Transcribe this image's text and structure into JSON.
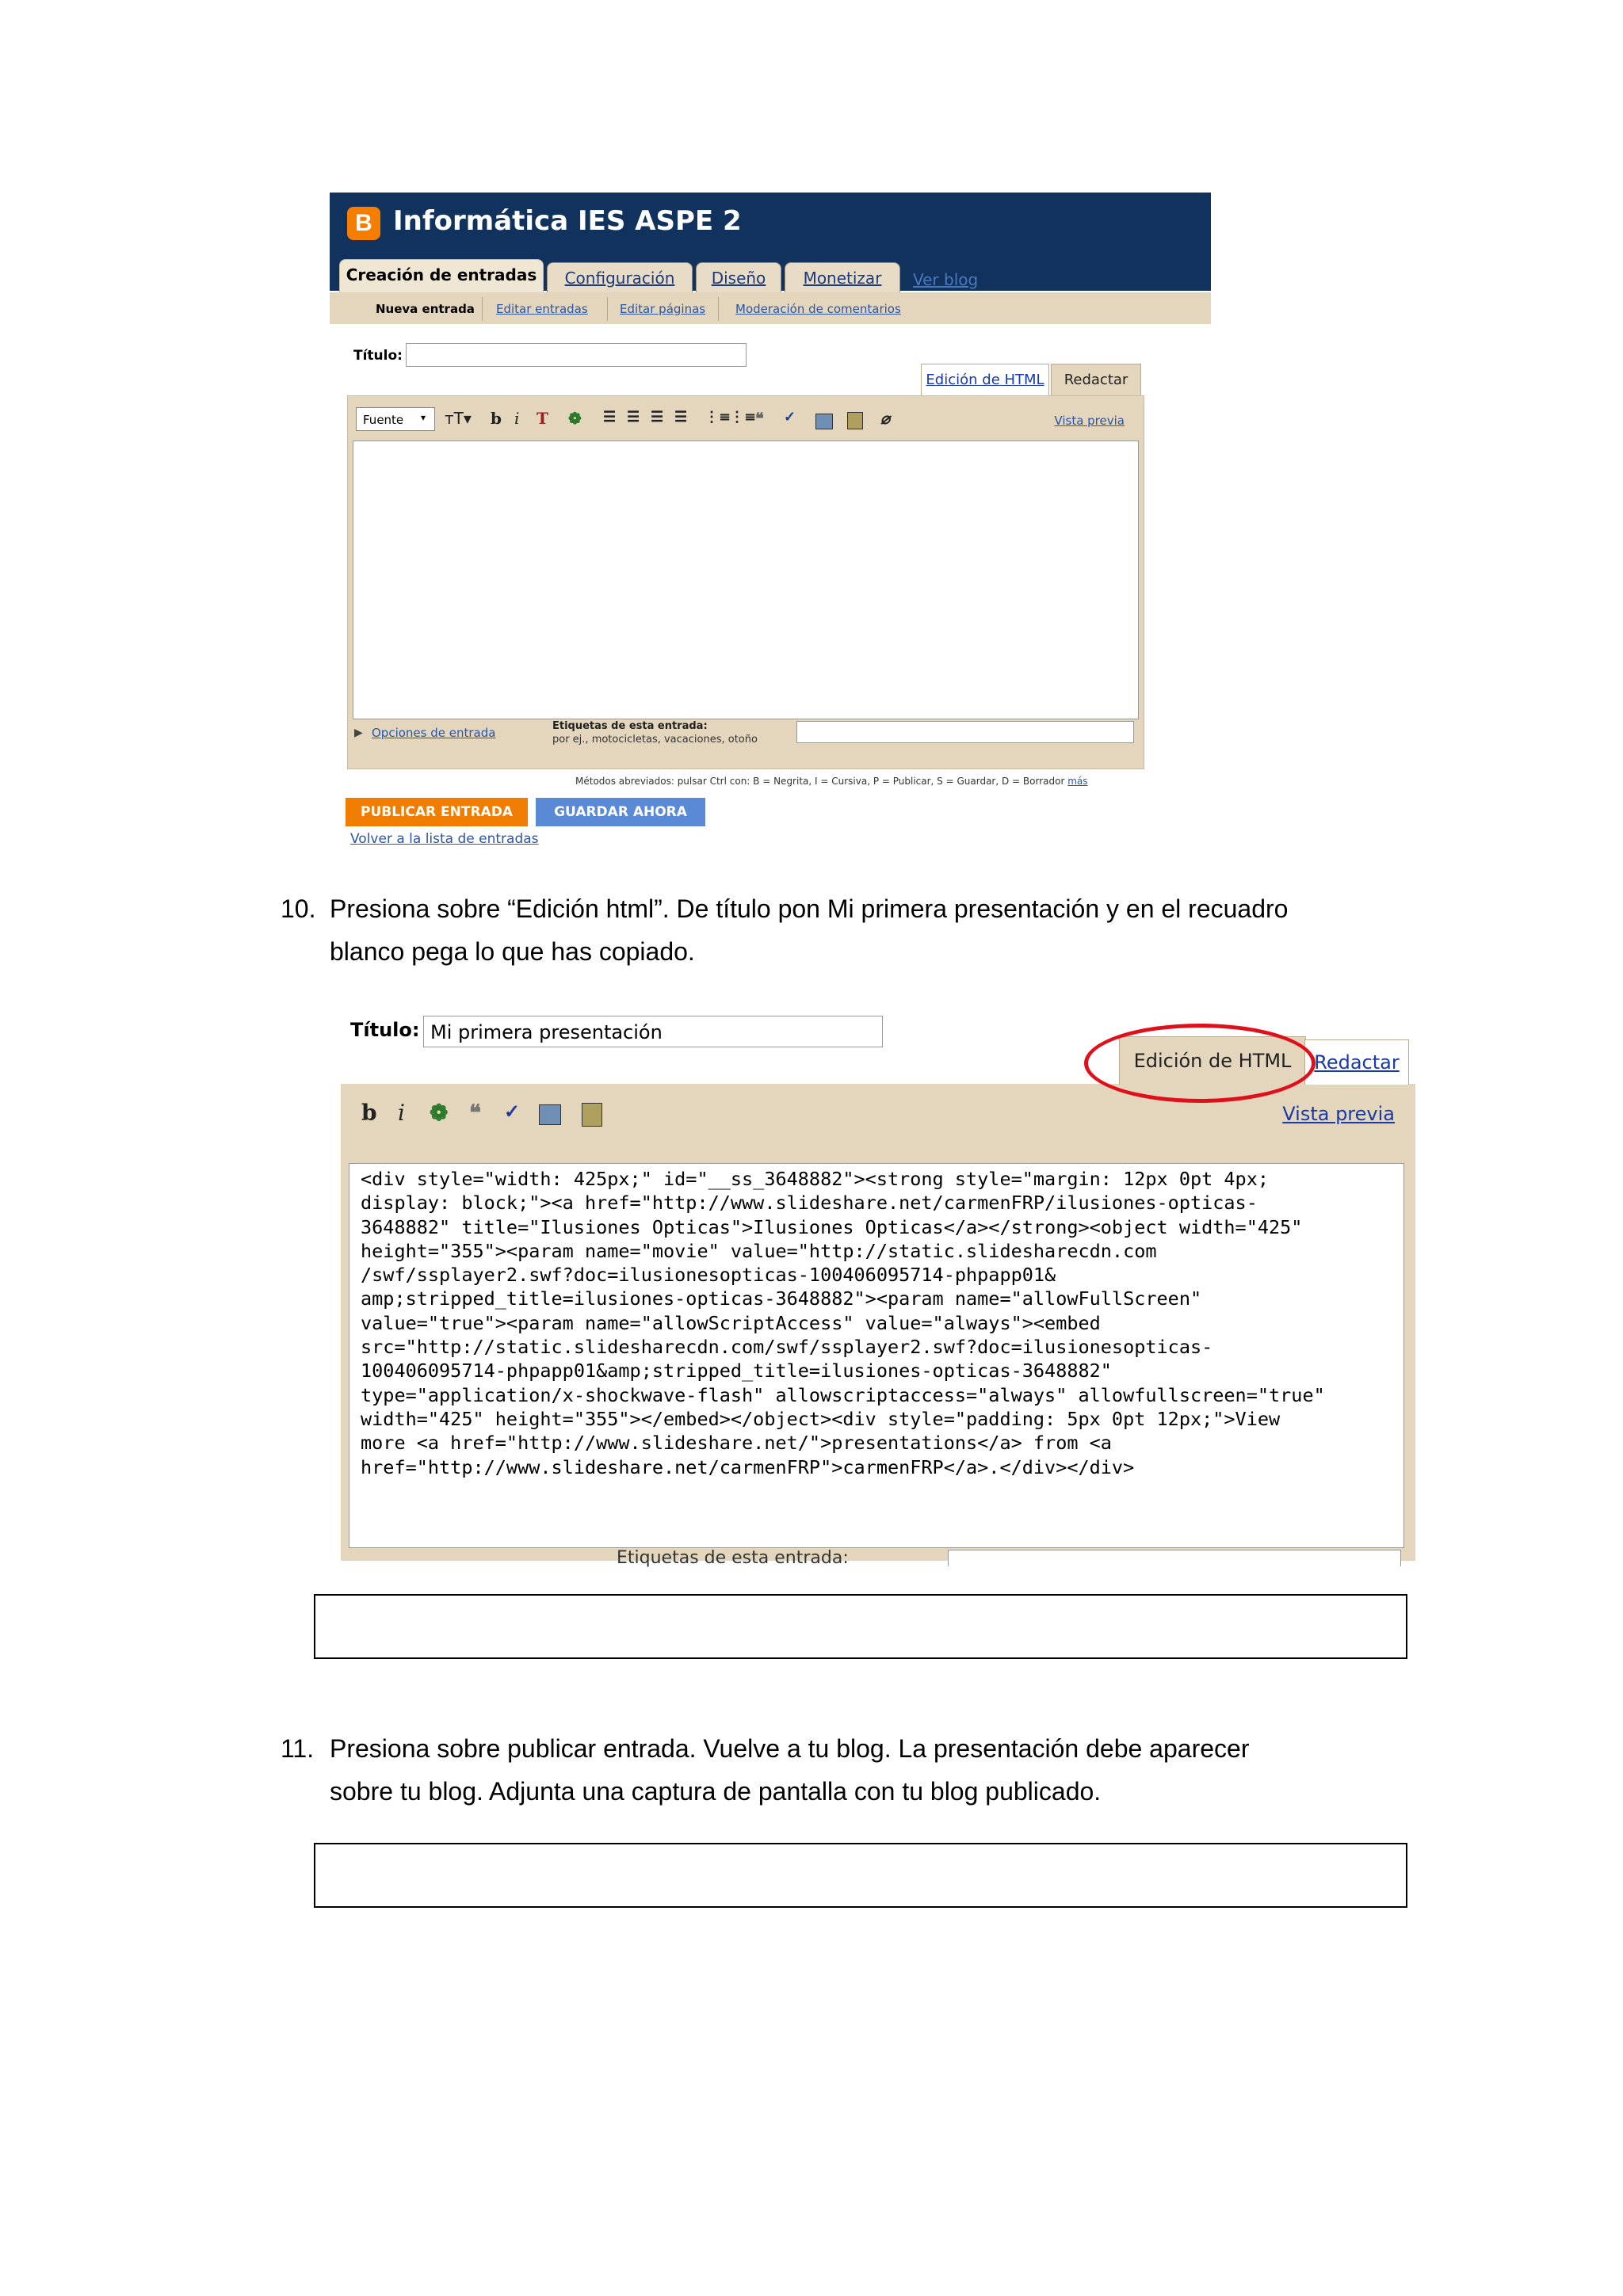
{
  "screenshot1": {
    "blog_title": "Informática IES ASPE 2",
    "logo_letter": "B",
    "tabs": [
      "Creación de entradas",
      "Configuración",
      "Diseño",
      "Monetizar"
    ],
    "ver_blog": "Ver blog",
    "subnav": [
      "Nueva entrada",
      "Editar entradas",
      "Editar páginas",
      "Moderación de comentarios"
    ],
    "titulo_label": "Título:",
    "edit_tabs": [
      "Edición de HTML",
      "Redactar"
    ],
    "font_select": "Fuente",
    "vista_previa": "Vista previa",
    "opciones": "Opciones de entrada",
    "etiquetas_label": "Etiquetas de esta entrada:",
    "etiquetas_hint": "por ej., motocicletas, vacaciones, otoño",
    "metodos": "Métodos abreviados: pulsar Ctrl con: B = Negrita, I = Cursiva, P = Publicar, S = Guardar, D = Borrador",
    "metodos_link": "más",
    "publicar": "PUBLICAR ENTRADA",
    "guardar": "GUARDAR AHORA",
    "volver": "Volver a la lista de entradas"
  },
  "step10": {
    "number": "10.",
    "line1": "Presiona sobre “Edición html”. De título pon Mi primera presentación y en el recuadro",
    "line2": "blanco pega lo que has copiado."
  },
  "screenshot2": {
    "titulo_label": "Título:",
    "titulo_value": "Mi primera presentación",
    "edit_html_tab": "Edición de HTML",
    "redactar_tab": "Redactar",
    "vista_previa": "Vista previa",
    "code_lines": [
      "<div style=\"width: 425px;\" id=\"__ss_3648882\"><strong style=\"margin: 12px 0pt 4px;",
      "display: block;\"><a href=\"http://www.slideshare.net/carmenFRP/ilusiones-opticas-",
      "3648882\" title=\"Ilusiones Opticas\">Ilusiones Opticas</a></strong><object width=\"425\"",
      "height=\"355\"><param name=\"movie\" value=\"http://static.slidesharecdn.com",
      "/swf/ssplayer2.swf?doc=ilusionesopticas-100406095714-phpapp01&",
      "amp;stripped_title=ilusiones-opticas-3648882\"><param name=\"allowFullScreen\"",
      "value=\"true\"><param name=\"allowScriptAccess\" value=\"always\"><embed",
      "src=\"http://static.slidesharecdn.com/swf/ssplayer2.swf?doc=ilusionesopticas-",
      "100406095714-phpapp01&amp;stripped_title=ilusiones-opticas-3648882\"",
      "type=\"application/x-shockwave-flash\" allowscriptaccess=\"always\" allowfullscreen=\"true\"",
      "width=\"425\" height=\"355\"></embed></object><div style=\"padding: 5px 0pt 12px;\">View",
      "more <a href=\"http://www.slideshare.net/\">presentations</a> from <a",
      "href=\"http://www.slideshare.net/carmenFRP\">carmenFRP</a>.</div></div>"
    ],
    "etiquetas_label": "Etiquetas de esta entrada:"
  },
  "step11": {
    "number": "11.",
    "line1": "Presiona sobre publicar entrada. Vuelve a tu blog. La presentación debe aparecer",
    "line2": "sobre tu blog. Adjunta una captura de pantalla con tu blog publicado."
  },
  "icons": [
    "blogger-logo-icon",
    "text-size-icon",
    "bold-icon",
    "italic-icon",
    "text-color-icon",
    "link-icon",
    "align-left-icon",
    "align-center-icon",
    "align-right-icon",
    "justify-icon",
    "numbered-list-icon",
    "bullet-list-icon",
    "blockquote-icon",
    "spellcheck-icon",
    "image-icon",
    "video-icon",
    "eraser-icon"
  ]
}
